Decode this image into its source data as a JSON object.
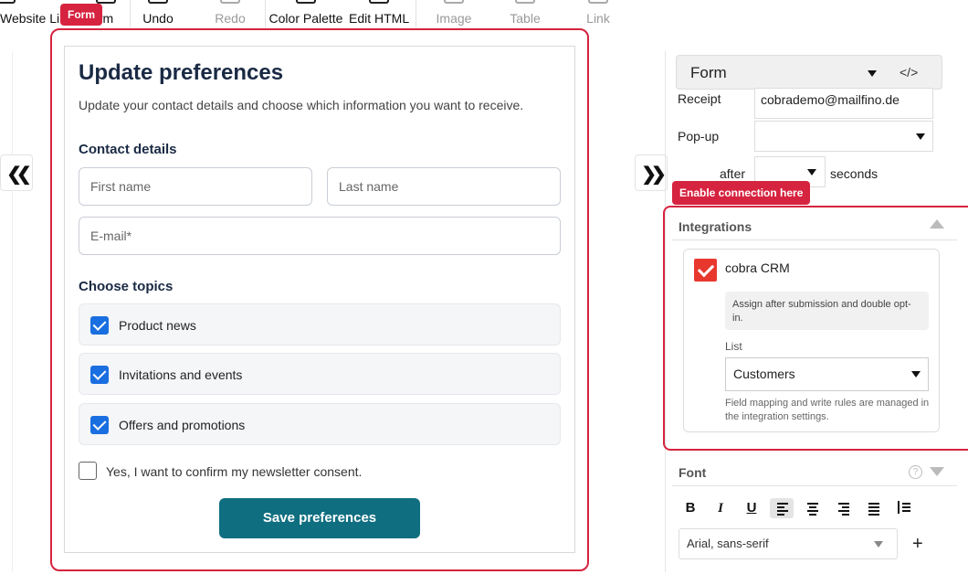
{
  "toolbar": {
    "items": [
      {
        "label": "Website Li"
      },
      {
        "label": "rm"
      },
      {
        "label": "Undo"
      },
      {
        "label": "Redo"
      },
      {
        "label": "Color Palette"
      },
      {
        "label": "Edit HTML"
      },
      {
        "label": "Image"
      },
      {
        "label": "Table"
      },
      {
        "label": "Link"
      }
    ],
    "form_tag": "Form"
  },
  "nav": {
    "left_arrow": "❮❮",
    "right_arrow": "❯❯"
  },
  "form": {
    "title": "Update preferences",
    "description": "Update your contact details and choose which information you want to receive.",
    "contact_heading": "Contact details",
    "first_name_placeholder": "First name",
    "last_name_placeholder": "Last name",
    "email_placeholder": "E-mail*",
    "topics_heading": "Choose topics",
    "topics": [
      {
        "label": "Product news",
        "checked": true
      },
      {
        "label": "Invitations and events",
        "checked": true
      },
      {
        "label": "Offers and promotions",
        "checked": true
      }
    ],
    "consent_label": "Yes, I want to confirm my newsletter consent.",
    "consent_checked": false,
    "save_label": "Save preferences"
  },
  "settings": {
    "element_select": "Form",
    "code_icon": "</>",
    "receipt_label": "Receipt",
    "receipt_value": "cobrademo@mailfino.de",
    "popup_label": "Pop-up",
    "popup_value": "",
    "after_label": "after",
    "after_value": "",
    "seconds_label": "seconds",
    "enable_tag": "Enable connection here"
  },
  "integrations": {
    "heading": "Integrations",
    "crm_name": "cobra CRM",
    "crm_checked": true,
    "assign_note": "Assign after submission and double opt-in.",
    "list_label": "List",
    "list_value": "Customers",
    "mapping_note": "Field mapping and write rules are managed in the integration settings."
  },
  "font_panel": {
    "heading": "Font",
    "help_icon": "?",
    "bold": "B",
    "italic": "I",
    "underline": "U",
    "font_value": "Arial, sans-serif",
    "add_icon": "+"
  },
  "colors": {
    "accent_red": "#d6233f",
    "save_teal": "#0f6e7f",
    "checkbox_blue": "#1a6fe0",
    "crm_red": "#e8382e"
  }
}
